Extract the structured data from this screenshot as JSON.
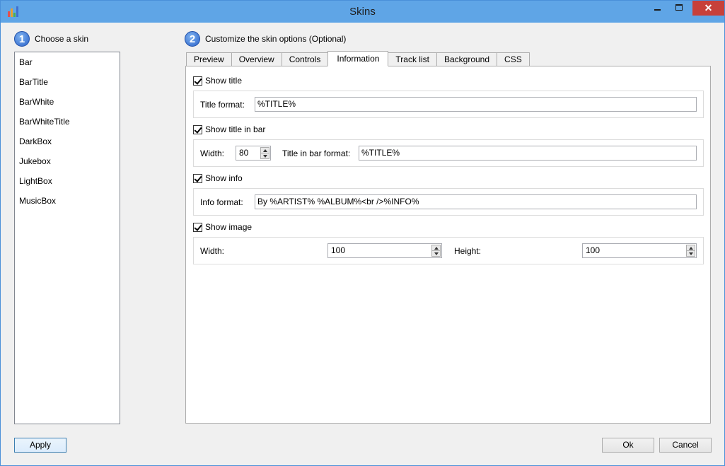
{
  "window": {
    "title": "Skins",
    "close_glyph": "✕",
    "accent_color": "#5fa5e6",
    "close_color": "#c7403a"
  },
  "step1": {
    "number": "1",
    "label": "Choose a skin"
  },
  "step2": {
    "number": "2",
    "label": "Customize the skin options (Optional)"
  },
  "skins": [
    "Bar",
    "BarTitle",
    "BarWhite",
    "BarWhiteTitle",
    "DarkBox",
    "Jukebox",
    "LightBox",
    "MusicBox"
  ],
  "tabs": [
    "Preview",
    "Overview",
    "Controls",
    "Information",
    "Track list",
    "Background",
    "CSS"
  ],
  "active_tab": "Information",
  "info": {
    "show_title": {
      "label": "Show title",
      "checked": true
    },
    "title_format": {
      "label": "Title format:",
      "value": "%TITLE%"
    },
    "show_title_in_bar": {
      "label": "Show title in bar",
      "checked": true
    },
    "bar": {
      "width_label": "Width:",
      "width_value": "80",
      "format_label": "Title in bar format:",
      "format_value": "%TITLE%"
    },
    "show_info": {
      "label": "Show info",
      "checked": true
    },
    "info_format": {
      "label": "Info format:",
      "value": "By %ARTIST% %ALBUM%<br />%INFO%"
    },
    "show_image": {
      "label": "Show image",
      "checked": true
    },
    "image": {
      "width_label": "Width:",
      "width_value": "100",
      "height_label": "Height:",
      "height_value": "100"
    }
  },
  "buttons": {
    "apply": "Apply",
    "ok": "Ok",
    "cancel": "Cancel"
  }
}
